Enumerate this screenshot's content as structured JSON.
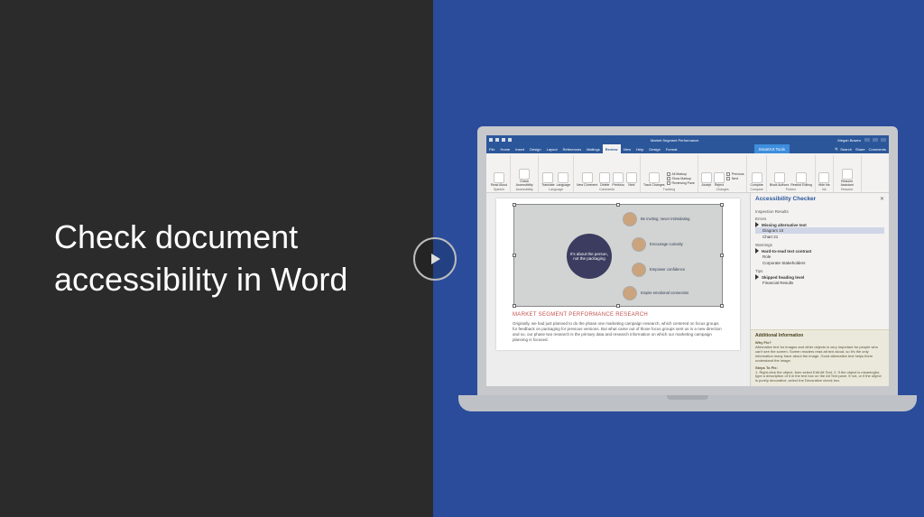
{
  "slide": {
    "title": "Check document accessibility in Word"
  },
  "titlebar": {
    "doc_name": "Market Segment Performance",
    "user": "Megan Bowen"
  },
  "tabs": {
    "items": [
      "File",
      "Home",
      "Insert",
      "Design",
      "Layout",
      "References",
      "Mailings",
      "Review",
      "View",
      "Help"
    ],
    "active": "Review",
    "contextual_title": "SmartArt Tools",
    "contextual_tabs": [
      "Design",
      "Format"
    ],
    "search_placeholder": "Search",
    "share": "Share",
    "comments": "Comments"
  },
  "ribbon": {
    "groups": [
      {
        "label": "Speech",
        "buttons": [
          "Read Aloud"
        ]
      },
      {
        "label": "Accessibility",
        "buttons": [
          "Check Accessibility"
        ]
      },
      {
        "label": "Language",
        "buttons": [
          "Translate",
          "Language"
        ]
      },
      {
        "label": "Comments",
        "buttons": [
          "New Comment",
          "Delete",
          "Previous",
          "Next"
        ]
      },
      {
        "label": "Tracking",
        "buttons": [
          "Track Changes"
        ],
        "options": [
          "All Markup",
          "Show Markup",
          "Reviewing Pane"
        ]
      },
      {
        "label": "Changes",
        "buttons": [
          "Accept",
          "Reject"
        ],
        "options": [
          "Previous",
          "Next"
        ]
      },
      {
        "label": "Compare",
        "buttons": [
          "Compare"
        ]
      },
      {
        "label": "Protect",
        "buttons": [
          "Block Authors",
          "Restrict Editing"
        ]
      },
      {
        "label": "Ink",
        "buttons": [
          "Hide Ink"
        ]
      },
      {
        "label": "Resume",
        "buttons": [
          "Resume Assistant"
        ]
      }
    ]
  },
  "document": {
    "smartart": {
      "hub": "It's about the person, not the packaging",
      "spokes": [
        "Be inviting; never intimidating",
        "Encourage curiosity",
        "Empower confidence",
        "Inspire emotional connection"
      ]
    },
    "heading": "MARKET SEGMENT PERFORMANCE RESEARCH",
    "paragraph": "Originally, we had just planned to do the phase one marketing campaign research, which centered on focus groups for feedback on packaging for previous versions. But what came out of those focus groups sent us in a new direction and so, our phase two research is the primary data and research information on which our marketing campaign planning is focused."
  },
  "accessibility_panel": {
    "title": "Accessibility Checker",
    "results_label": "Inspection Results",
    "sections": [
      {
        "category": "Errors",
        "groups": [
          {
            "rule": "Missing alternative text",
            "entries": [
              "Diagram 10",
              "Chart 21"
            ],
            "selected": 0
          }
        ]
      },
      {
        "category": "Warnings",
        "groups": [
          {
            "rule": "Hard-to-read text contrast",
            "entries": [
              "Role",
              "Corporate Stakeholders"
            ]
          }
        ]
      },
      {
        "category": "Tips",
        "groups": [
          {
            "rule": "Skipped heading level",
            "entries": [
              "Financial Results"
            ]
          }
        ]
      }
    ],
    "info": {
      "title": "Additional Information",
      "why_label": "Why Fix?",
      "why_text": "Alternative text for images and other objects is very important for people who can't see the screen. Screen readers read alt text aloud, so it's the only information many have about the image. Good alternative text helps them understand the image.",
      "steps_label": "Steps To Fix:",
      "steps_text": "1. Right-click the object, then select Edit Alt Text. 2. If the object is meaningful, type a description of it in the text box on the Alt Text pane. If not, or if the object is purely decorative, select the Decorative check box."
    }
  }
}
